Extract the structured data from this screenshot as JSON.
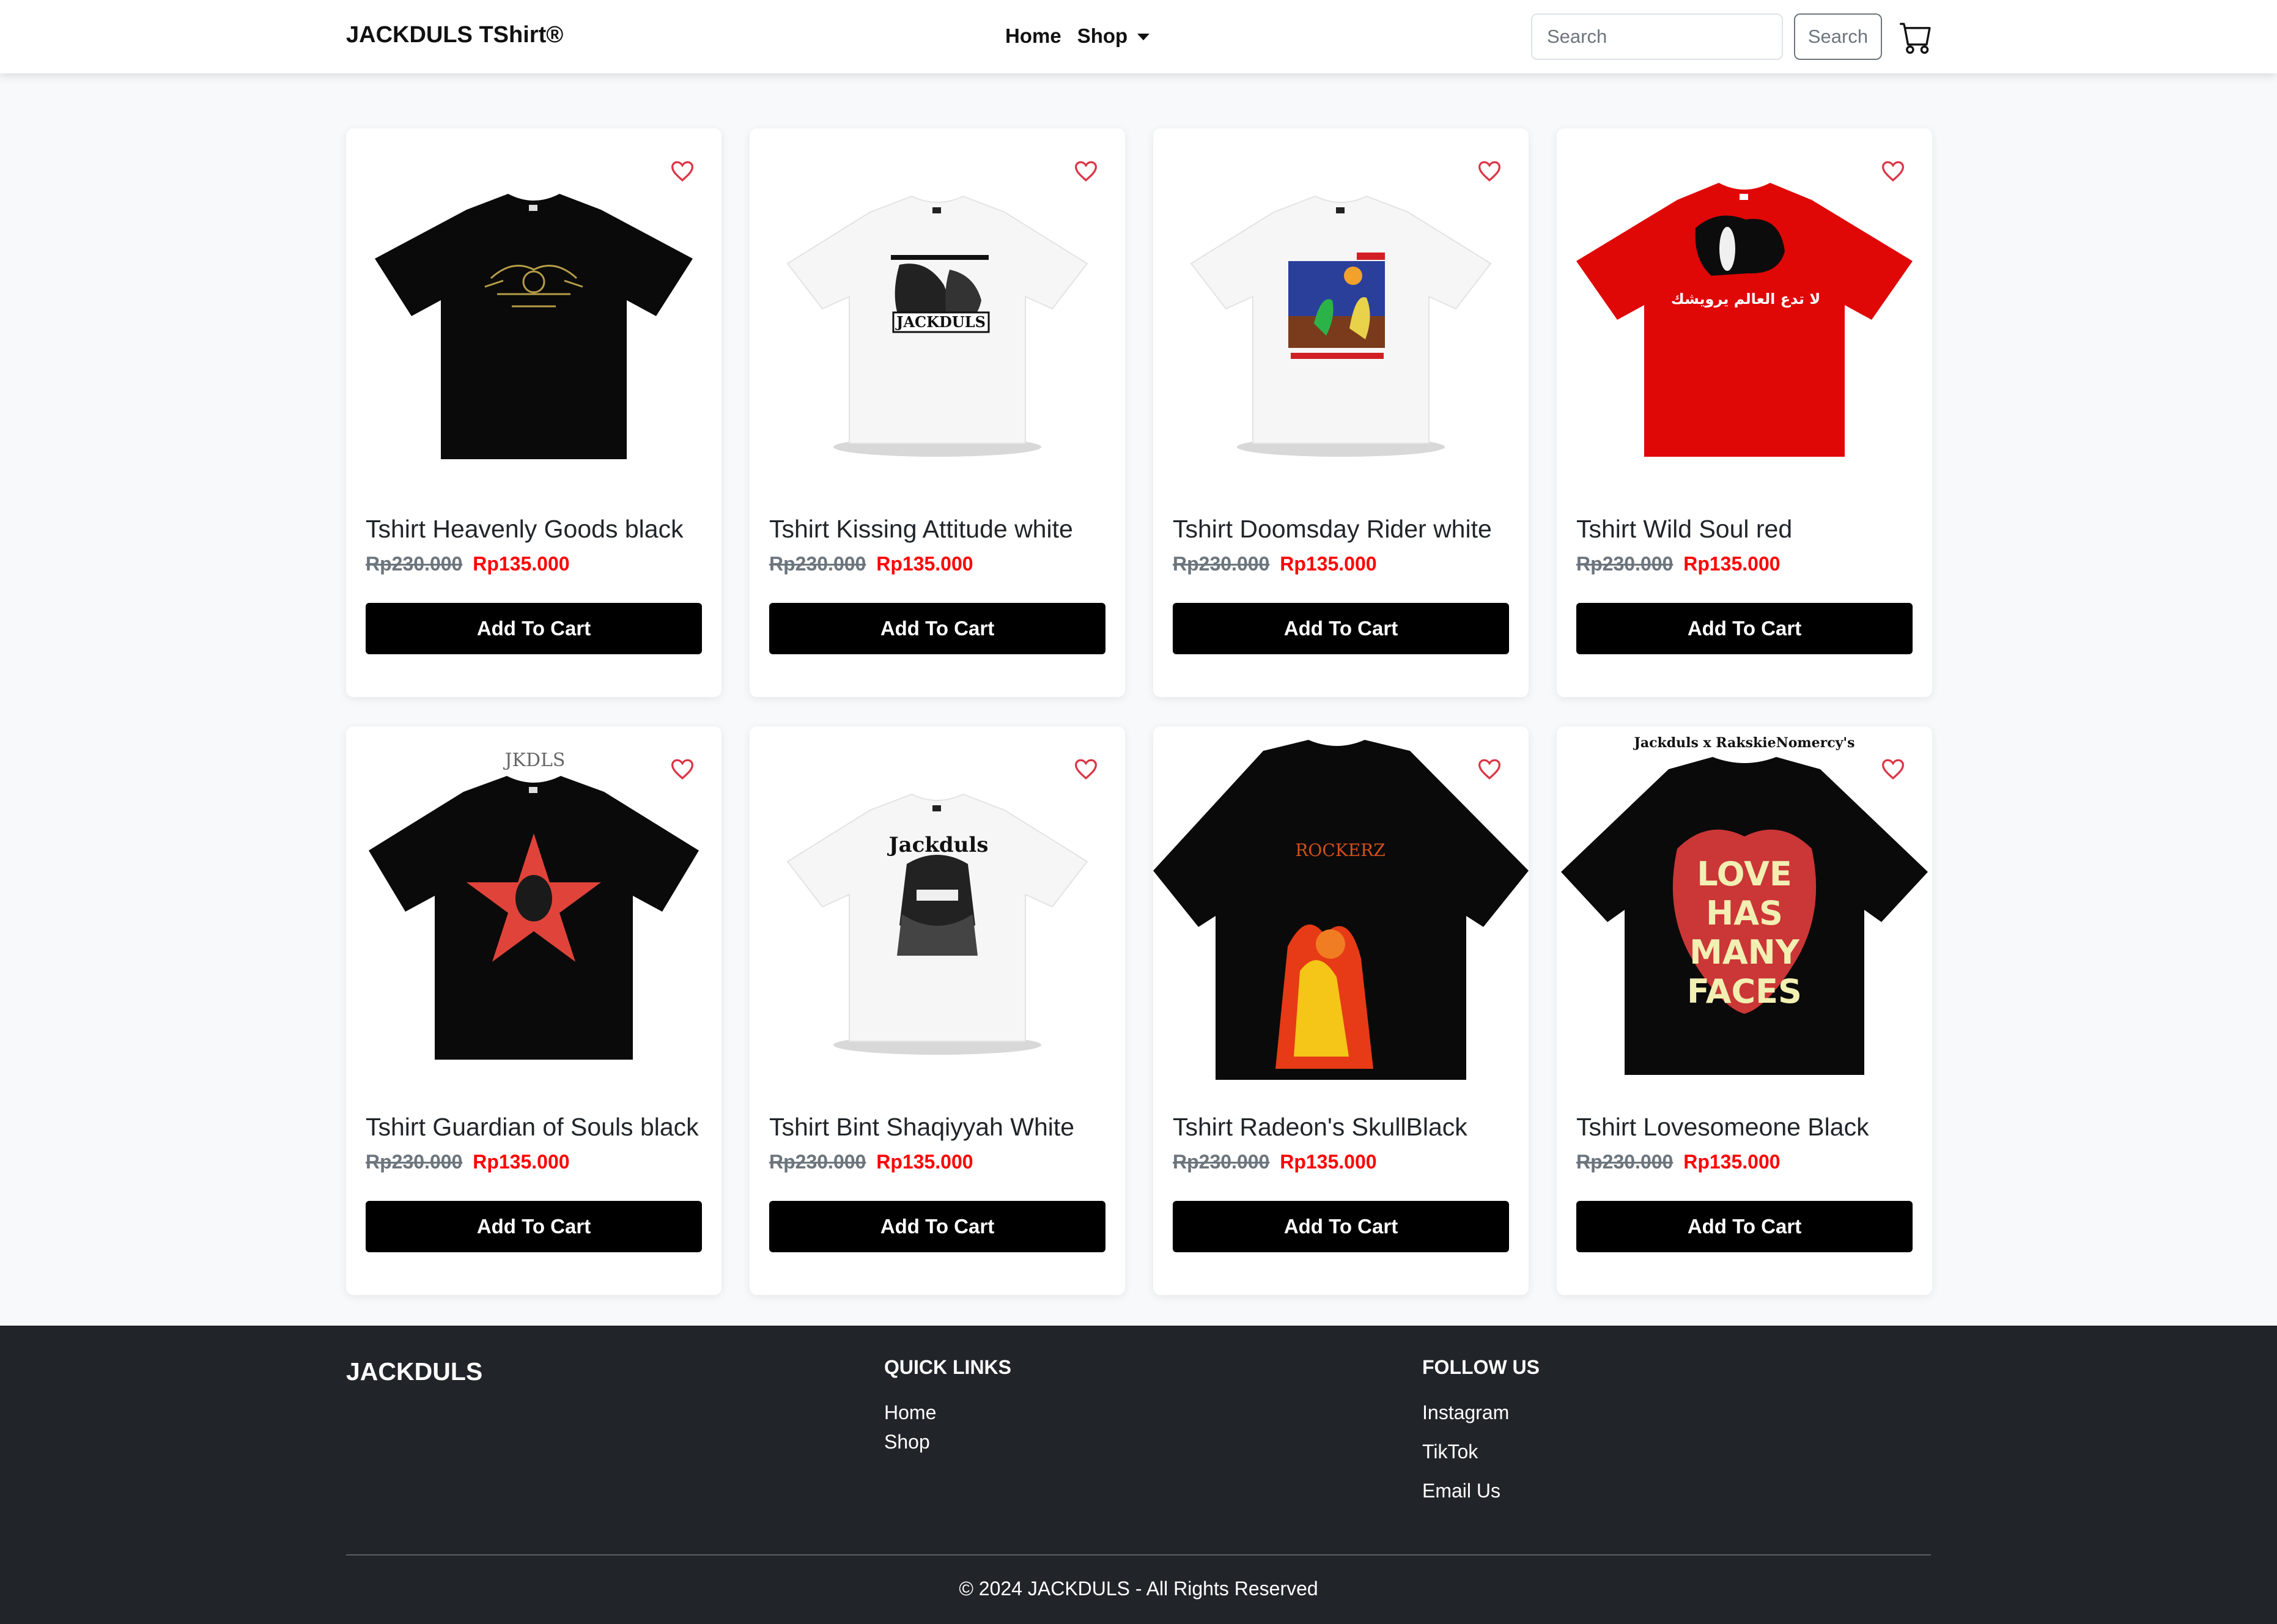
{
  "navbar": {
    "brand": "JACKDULS TShirt®",
    "links": {
      "home": "Home",
      "shop": "Shop"
    },
    "search": {
      "placeholder": "Search",
      "button": "Search"
    },
    "cart_icon": "cart-icon"
  },
  "products": [
    {
      "title": "Tshirt Heavenly Goods black",
      "old_price": "Rp230.000",
      "new_price": "Rp135.000",
      "button": "Add To Cart"
    },
    {
      "title": "Tshirt Kissing Attitude white",
      "old_price": "Rp230.000",
      "new_price": "Rp135.000",
      "button": "Add To Cart"
    },
    {
      "title": "Tshirt Doomsday Rider white",
      "old_price": "Rp230.000",
      "new_price": "Rp135.000",
      "button": "Add To Cart"
    },
    {
      "title": "Tshirt Wild Soul red",
      "old_price": "Rp230.000",
      "new_price": "Rp135.000",
      "button": "Add To Cart"
    },
    {
      "title": "Tshirt Guardian of Souls black",
      "old_price": "Rp230.000",
      "new_price": "Rp135.000",
      "button": "Add To Cart"
    },
    {
      "title": "Tshirt Bint Shaqiyyah White",
      "old_price": "Rp230.000",
      "new_price": "Rp135.000",
      "button": "Add To Cart"
    },
    {
      "title": "Tshirt Radeon's SkullBlack",
      "old_price": "Rp230.000",
      "new_price": "Rp135.000",
      "button": "Add To Cart"
    },
    {
      "title": "Tshirt Lovesomeone Black",
      "old_price": "Rp230.000",
      "new_price": "Rp135.000",
      "button": "Add To Cart"
    }
  ],
  "product_images": {
    "p4_text": "لا تدع العالم يرويشك",
    "p8_top": "Jackduls x RakskieNomercy's",
    "p8_art": [
      "LOVE",
      "HAS",
      "MANY",
      "FACES"
    ]
  },
  "footer": {
    "brand": "JACKDULS",
    "quick_links": {
      "heading": "QUICK LINKS",
      "home": "Home",
      "shop": "Shop"
    },
    "follow": {
      "heading": "FOLLOW US",
      "instagram": "Instagram",
      "tiktok": "TikTok",
      "email": "Email Us"
    },
    "copyright": "© 2024 JACKDULS - All Rights Reserved"
  },
  "colors": {
    "accent_red": "#ff0000",
    "footer_bg": "#212529",
    "button_bg": "#000000"
  }
}
